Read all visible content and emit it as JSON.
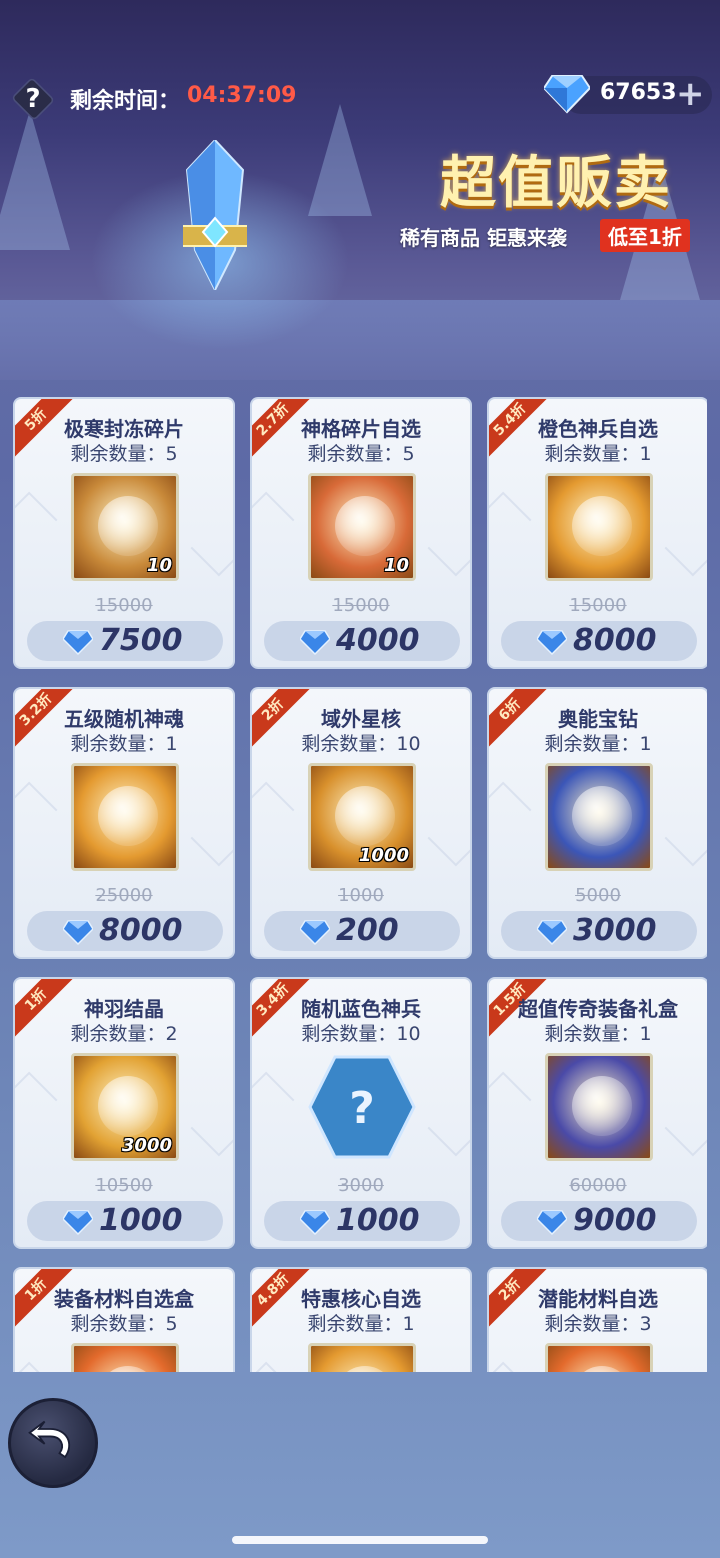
{
  "header": {
    "timer_label": "剩余时间：",
    "timer_value": "04:37:09",
    "gem_count": "67653",
    "plus_icon": "plus-icon"
  },
  "promo": {
    "title": "超值贩卖",
    "subtitle": "稀有商品 钜惠来袭",
    "badge": "低至1折"
  },
  "remain_label": "剩余数量：",
  "items": [
    {
      "discount": "5折",
      "name": "极寒封冻碎片",
      "remain": "剩余数量：5",
      "qty": "10",
      "old_price": "15000",
      "price": "7500",
      "thumb_color": "#c98a3a"
    },
    {
      "discount": "2.7折",
      "name": "神格碎片自选",
      "remain": "剩余数量：5",
      "qty": "10",
      "old_price": "15000",
      "price": "4000",
      "thumb_color": "#d86a38"
    },
    {
      "discount": "5.4折",
      "name": "橙色神兵自选",
      "remain": "剩余数量：1",
      "qty": "",
      "old_price": "15000",
      "price": "8000",
      "thumb_color": "#e49a30"
    },
    {
      "discount": "3.2折",
      "name": "五级随机神魂",
      "remain": "剩余数量：1",
      "qty": "",
      "old_price": "25000",
      "price": "8000",
      "thumb_color": "#e49a30"
    },
    {
      "discount": "2折",
      "name": "域外星核",
      "remain": "剩余数量：10",
      "qty": "1000",
      "old_price": "1000",
      "price": "200",
      "thumb_color": "#d8902c"
    },
    {
      "discount": "6折",
      "name": "奥能宝钻",
      "remain": "剩余数量：1",
      "qty": "",
      "old_price": "5000",
      "price": "3000",
      "thumb_color": "#3b56b8"
    },
    {
      "discount": "1折",
      "name": "神羽结晶",
      "remain": "剩余数量：2",
      "qty": "3000",
      "old_price": "10500",
      "price": "1000",
      "thumb_color": "#e2a233"
    },
    {
      "discount": "3.4折",
      "name": "随机蓝色神兵",
      "remain": "剩余数量：10",
      "qty": "",
      "old_price": "3000",
      "price": "1000",
      "thumb_color": "#3a86c8"
    },
    {
      "discount": "1.5折",
      "name": "超值传奇装备礼盒",
      "remain": "剩余数量：1",
      "qty": "",
      "old_price": "60000",
      "price": "9000",
      "thumb_color": "#4a4aa8"
    },
    {
      "discount": "1折",
      "name": "装备材料自选盒",
      "remain": "剩余数量：5",
      "qty": "",
      "old_price": "",
      "price": "",
      "thumb_color": "#e36a2c"
    },
    {
      "discount": "4.8折",
      "name": "特惠核心自选",
      "remain": "剩余数量：1",
      "qty": "",
      "old_price": "",
      "price": "",
      "thumb_color": "#e49a30"
    },
    {
      "discount": "2折",
      "name": "潜能材料自选",
      "remain": "剩余数量：3",
      "qty": "",
      "old_price": "",
      "price": "",
      "thumb_color": "#e36a2c"
    }
  ],
  "colors": {
    "accent_red": "#ff5a47",
    "ribbon": "#c9391b",
    "gem_blue": "#3a86e8"
  }
}
